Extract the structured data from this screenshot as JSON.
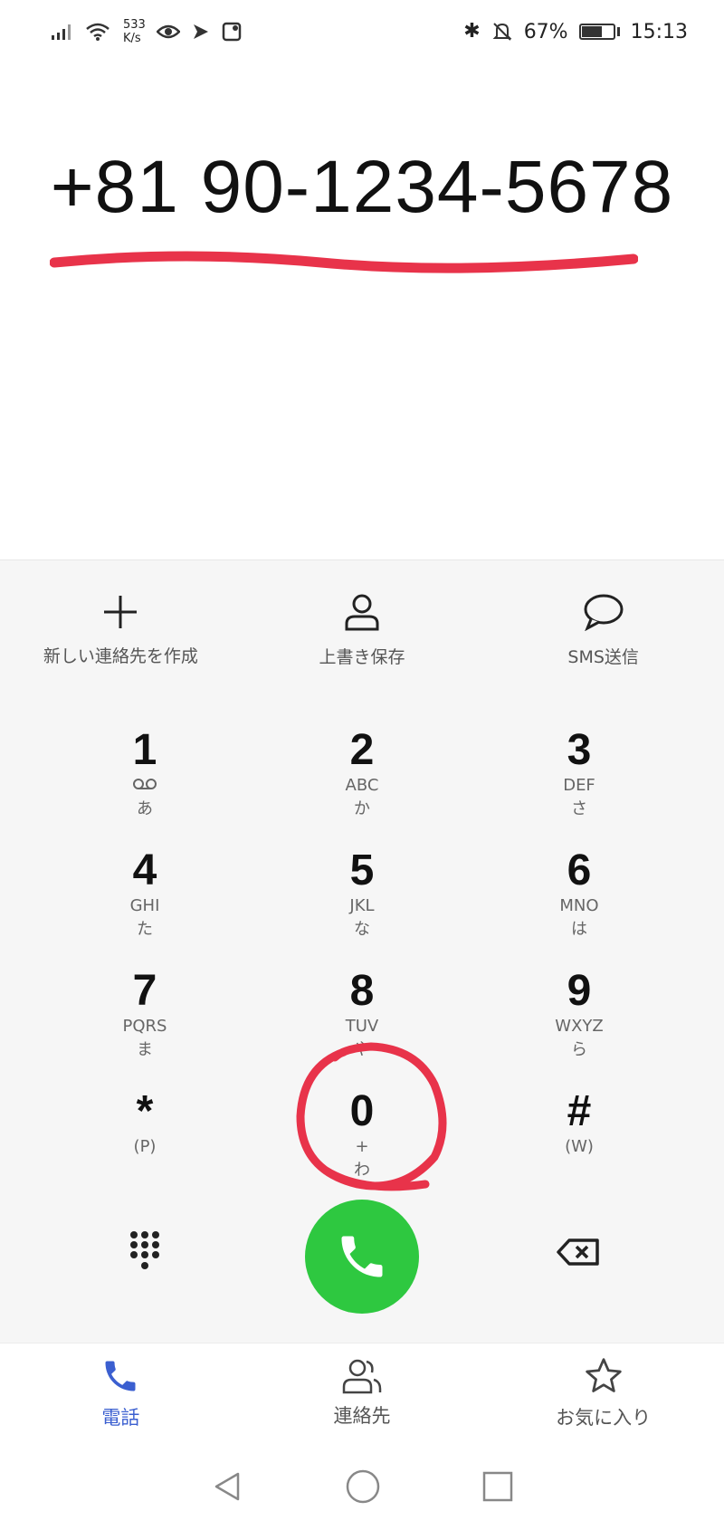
{
  "status_bar": {
    "speed_value": "533",
    "speed_unit": "K/s",
    "battery": "67%",
    "battery_level": 0.67,
    "time": "15:13"
  },
  "dialer": {
    "number": "+81 90-1234-5678"
  },
  "actions": [
    {
      "label": "新しい連絡先を作成",
      "icon": "plus-icon"
    },
    {
      "label": "上書き保存",
      "icon": "person-icon"
    },
    {
      "label": "SMS送信",
      "icon": "chat-bubble-icon"
    }
  ],
  "keys": [
    {
      "digit": "1",
      "sub1": "",
      "sub2": "あ",
      "icon": "voicemail-icon"
    },
    {
      "digit": "2",
      "sub1": "ABC",
      "sub2": "か"
    },
    {
      "digit": "3",
      "sub1": "DEF",
      "sub2": "さ"
    },
    {
      "digit": "4",
      "sub1": "GHI",
      "sub2": "た"
    },
    {
      "digit": "5",
      "sub1": "JKL",
      "sub2": "な"
    },
    {
      "digit": "6",
      "sub1": "MNO",
      "sub2": "は"
    },
    {
      "digit": "7",
      "sub1": "PQRS",
      "sub2": "ま"
    },
    {
      "digit": "8",
      "sub1": "TUV",
      "sub2": "や"
    },
    {
      "digit": "9",
      "sub1": "WXYZ",
      "sub2": "ら"
    },
    {
      "digit": "*",
      "sub1": "(P)",
      "sub2": ""
    },
    {
      "digit": "0",
      "sub1": "+",
      "sub2": "わ"
    },
    {
      "digit": "#",
      "sub1": "(W)",
      "sub2": ""
    }
  ],
  "bottom_nav": [
    {
      "label": "電話",
      "icon": "phone-icon",
      "active": true
    },
    {
      "label": "連絡先",
      "icon": "contacts-icon",
      "active": false
    },
    {
      "label": "お気に入り",
      "icon": "star-icon",
      "active": false
    }
  ],
  "colors": {
    "call_button": "#2ec840",
    "accent": "#3b5fd0",
    "annotation": "#e8334a"
  }
}
